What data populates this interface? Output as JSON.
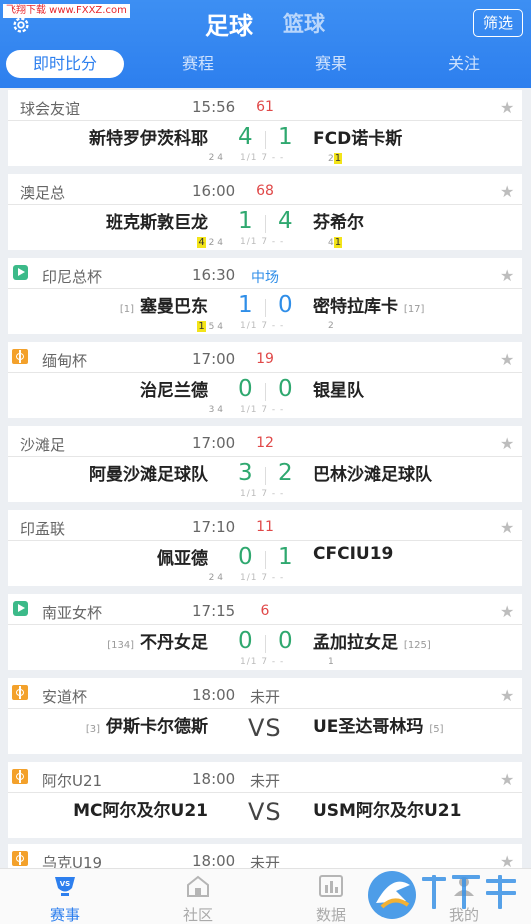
{
  "watermark": "飞翔下载 www.FXXZ.com",
  "header": {
    "title_football": "足球",
    "title_basketball": "篮球",
    "filter_label": "筛选",
    "tabs": [
      "即时比分",
      "赛程",
      "赛果",
      "关注"
    ]
  },
  "matches": [
    {
      "league": "球会友谊",
      "time": "15:56",
      "status": "61",
      "home": "新特罗伊茨科耶",
      "away": "FCD诺卡斯",
      "home_score": "4",
      "away_score": "1",
      "note_l": "2 4",
      "note_r": "2",
      "note_r_yc": "1",
      "note_m": "1/1 7 - -"
    },
    {
      "league": "澳足总",
      "time": "16:00",
      "status": "68",
      "home": "班克斯敦巨龙",
      "away": "芬希尔",
      "home_score": "1",
      "away_score": "4",
      "note_l_yc": "4",
      "note_l": "2 4",
      "note_r": "4",
      "note_r_yc": "1",
      "note_m": "1/1 7 - -"
    },
    {
      "league": "印尼总杯",
      "time": "16:30",
      "status": "中场",
      "home": "塞曼巴东",
      "home_rank": "[1]",
      "away": "密特拉库卡",
      "away_rank": "[17]",
      "home_score": "1",
      "away_score": "0",
      "note_l_yc": "1",
      "note_l": "5 4",
      "note_r": "2",
      "note_m": "1/1 7 - -"
    },
    {
      "league": "缅甸杯",
      "time": "17:00",
      "status": "19",
      "home": "治尼兰德",
      "away": "银星队",
      "home_score": "0",
      "away_score": "0",
      "note_l": "3 4",
      "note_m": "1/1 7 - -"
    },
    {
      "league": "沙滩足",
      "time": "17:00",
      "status": "12",
      "home": "阿曼沙滩足球队",
      "away": "巴林沙滩足球队",
      "home_score": "3",
      "away_score": "2",
      "note_m": "1/1 7 - -"
    },
    {
      "league": "印孟联",
      "time": "17:10",
      "status": "11",
      "home": "佩亚德",
      "away": "CFCIU19",
      "home_score": "0",
      "away_score": "1",
      "note_l": "2 4",
      "note_m": "1/1 7 - -"
    },
    {
      "league": "南亚女杯",
      "time": "17:15",
      "status": "6",
      "home": "不丹女足",
      "home_rank": "[134]",
      "away": "孟加拉女足",
      "away_rank": "[125]",
      "home_score": "0",
      "away_score": "0",
      "note_r": "1",
      "note_m": "1/1 7 - -"
    },
    {
      "league": "安道杯",
      "time": "18:00",
      "status": "未开",
      "home": "伊斯卡尔德斯",
      "home_rank": "[3]",
      "away": "UE圣达哥林玛",
      "away_rank": "[5]",
      "vs": "VS"
    },
    {
      "league": "阿尔U21",
      "time": "18:00",
      "status": "未开",
      "home": "MC阿尔及尔U21",
      "away": "USM阿尔及尔U21",
      "vs": "VS"
    },
    {
      "league": "乌克U19",
      "time": "18:00",
      "status": "未开"
    }
  ],
  "bottom_nav": [
    "赛事",
    "社区",
    "数据",
    "我的"
  ]
}
